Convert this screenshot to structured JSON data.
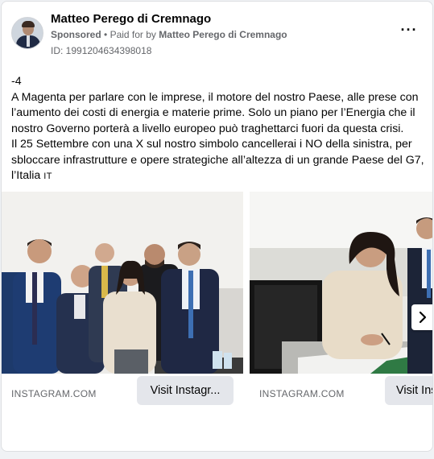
{
  "post": {
    "author": "Matteo Perego di Cremnago",
    "sponsored_label": "Sponsored",
    "paid_for_prefix": "Paid for by",
    "paid_for_by": "Matteo Perego di Cremnago",
    "separator": "•",
    "ad_id": "ID: 1991204634398018",
    "more_glyph": "···",
    "text_lines": [
      "-4",
      "A Magenta per parlare con le imprese, il motore del nostro Paese, alle prese con",
      "l’aumento dei costi di energia e materie prime. Solo un piano per l’Energia che il",
      "nostro Governo porterà a livello europeo può traghettarci fuori da questa crisi.",
      "Il 25 Settembre con una X sul nostro simbolo cancellerai i NO della sinistra, per",
      "sbloccare infrastrutture e opere strategiche all’altezza di un grande Paese del G7,"
    ],
    "last_line_text": "l’Italia ",
    "flag_text": "IT"
  },
  "carousel": {
    "cards": [
      {
        "domain": "INSTAGRAM.COM",
        "cta": "Visit Instagr..."
      },
      {
        "domain": "INSTAGRAM.COM",
        "cta": "Visit Ins"
      }
    ],
    "next_icon": "chevron-right-icon"
  }
}
